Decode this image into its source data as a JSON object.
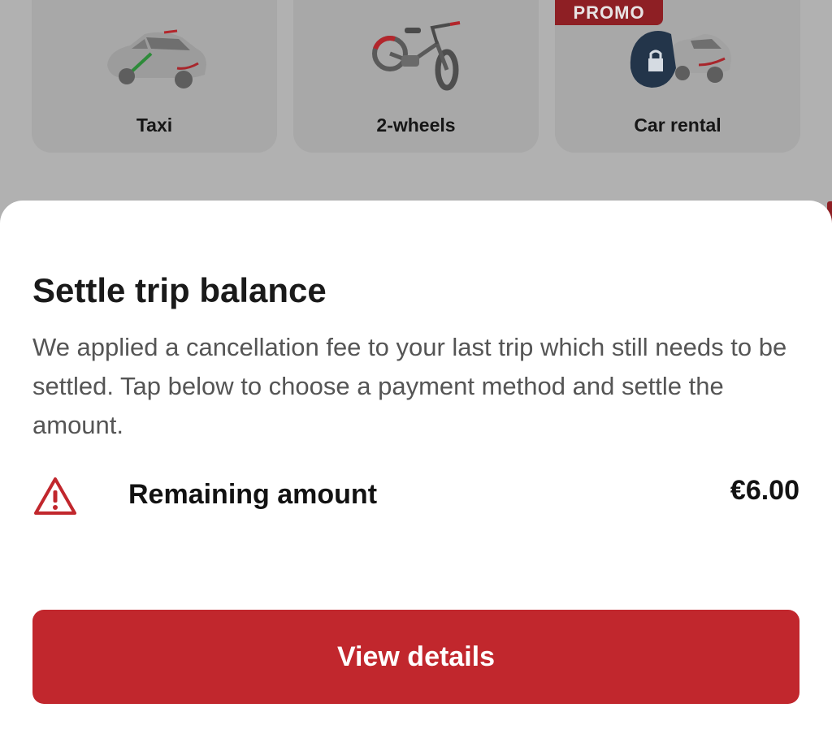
{
  "services": [
    {
      "label": "Taxi",
      "icon": "taxi-car-icon"
    },
    {
      "label": "2-wheels",
      "icon": "bicycle-icon"
    },
    {
      "label": "Car rental",
      "icon": "car-key-icon",
      "badge": "PROMO"
    }
  ],
  "sheet": {
    "title": "Settle trip balance",
    "description": "We applied a cancellation fee to your last trip which still needs to be settled. Tap below to choose a payment method and settle the amount.",
    "warning_icon": "warning-triangle-icon",
    "amount_label": "Remaining amount",
    "amount_value": "€6.00",
    "button_label": "View details"
  },
  "colors": {
    "brand_red": "#c1272d",
    "promo_red": "#8e1f24",
    "overlay": "#b1b1b1"
  }
}
